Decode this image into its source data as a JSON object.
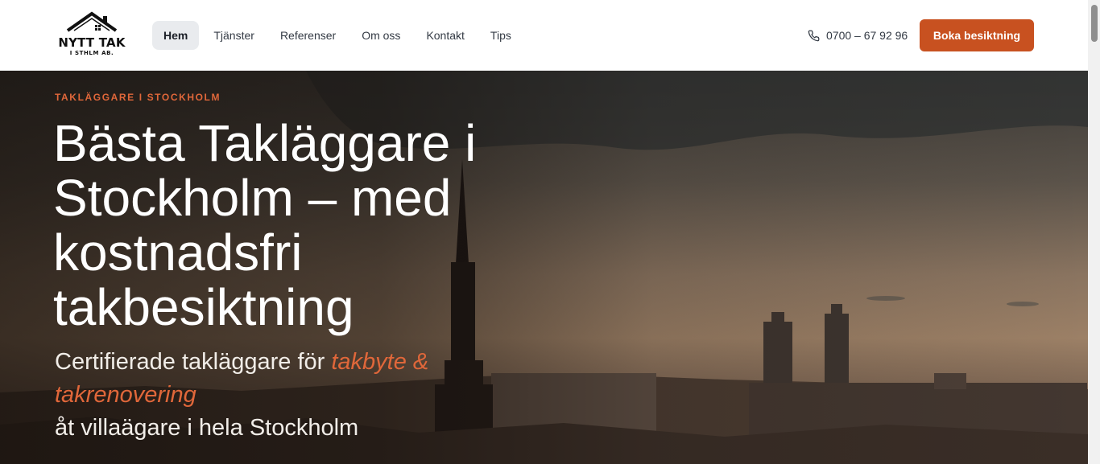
{
  "header": {
    "logo": {
      "brand": "NYTT TAK",
      "sub": "I STHLM AB."
    },
    "nav": [
      {
        "label": "Hem",
        "active": true
      },
      {
        "label": "Tjänster",
        "active": false
      },
      {
        "label": "Referenser",
        "active": false
      },
      {
        "label": "Om oss",
        "active": false
      },
      {
        "label": "Kontakt",
        "active": false
      },
      {
        "label": "Tips",
        "active": false
      }
    ],
    "phone": "0700 – 67 92 96",
    "cta_label": "Boka besiktning"
  },
  "hero": {
    "eyebrow": "TAKLÄGGARE I STOCKHOLM",
    "headline": "Bästa Takläggare i Stockholm – med kostnadsfri takbesiktning",
    "sub_prefix": "Certifierade takläggare för ",
    "sub_accent": "takbyte & takrenovering",
    "sub_suffix": "åt villaägare i hela Stockholm"
  },
  "colors": {
    "accent": "#c85120",
    "accent_text": "#e0673a",
    "nav_active_bg": "#e9ebee"
  },
  "icons": {
    "phone": "phone-icon",
    "logo": "house-roof-icon"
  }
}
